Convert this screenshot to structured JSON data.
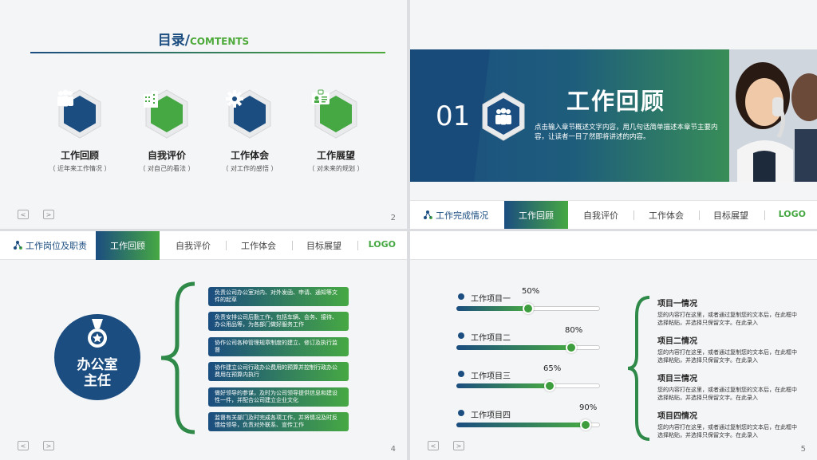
{
  "slide1": {
    "title_cn": "目录/",
    "title_en": "COMTENTS",
    "items": [
      {
        "label": "工作回顾",
        "sub": "（ 近年来工作情况 ）",
        "color": "#1b4d80",
        "icon": "team-icon"
      },
      {
        "label": "自我评价",
        "sub": "（ 对自己的看法 ）",
        "color": "#46a843",
        "icon": "building-icon"
      },
      {
        "label": "工作体会",
        "sub": "（ 对工作的感悟 ）",
        "color": "#1b4d80",
        "icon": "gear-icon"
      },
      {
        "label": "工作展望",
        "sub": "（ 对未来的规划 ）",
        "color": "#46a843",
        "icon": "id-card-icon"
      }
    ],
    "page": "2",
    "prev": "<",
    "next": ">"
  },
  "slide2": {
    "number": "01",
    "title": "工作回顾",
    "desc": "点击输入章节概述文字内容，用几句话简单描述本章节主要内容，让读者一目了然即将讲述的内容。"
  },
  "tabbar1": {
    "left": "工作岗位及职责",
    "tabs": [
      "工作回顾",
      "自我评价",
      "工作体会",
      "目标展望"
    ],
    "logo": "LOGO"
  },
  "tabbar2": {
    "left": "工作完成情况",
    "tabs": [
      "工作回顾",
      "自我评价",
      "工作体会",
      "目标展望"
    ],
    "logo": "LOGO"
  },
  "slide3": {
    "circle_line1": "办公室",
    "circle_line2": "主任",
    "duties": [
      "负责公司办公室对内、对外发函、申请、通知等文件的起草",
      "负责安排公司后勤工作，包括车辆、会务、接待、办公用品等，为各部门做好服务工作",
      "协作公司各种管理规章制度的建立、修订及执行监督",
      "协作建立公司行政办公费用的预算并控制行政办公费用在预算内执行",
      "做好领导的参谋，及时为公司领导提供信息和建设性一件，并配合公司建立企业文化",
      "监督有关部门及时完成各项工作，并将情况及时反馈给领导，负责对外联系、宣传工作"
    ],
    "page": "4",
    "prev": "<",
    "next": ">"
  },
  "slide4": {
    "progress": [
      {
        "label": "工作项目一",
        "pct": "50%",
        "value": 0.5
      },
      {
        "label": "工作项目二",
        "pct": "80%",
        "value": 0.8
      },
      {
        "label": "工作项目三",
        "pct": "65%",
        "value": 0.65
      },
      {
        "label": "工作项目四",
        "pct": "90%",
        "value": 0.9
      }
    ],
    "projects": [
      {
        "title": "项目一情况",
        "text": "您的内容打在这里，或者通过复制您的文本后，在此框中选择粘贴，并选择只保留文字。在此录入"
      },
      {
        "title": "项目二情况",
        "text": "您的内容打在这里，或者通过复制您的文本后，在此框中选择粘贴，并选择只保留文字。在此录入"
      },
      {
        "title": "项目三情况",
        "text": "您的内容打在这里，或者通过复制您的文本后，在此框中选择粘贴，并选择只保留文字。在此录入"
      },
      {
        "title": "项目四情况",
        "text": "您的内容打在这里，或者通过复制您的文本后，在此框中选择粘贴，并选择只保留文字。在此录入"
      }
    ],
    "page": "5",
    "prev": "<",
    "next": ">"
  }
}
